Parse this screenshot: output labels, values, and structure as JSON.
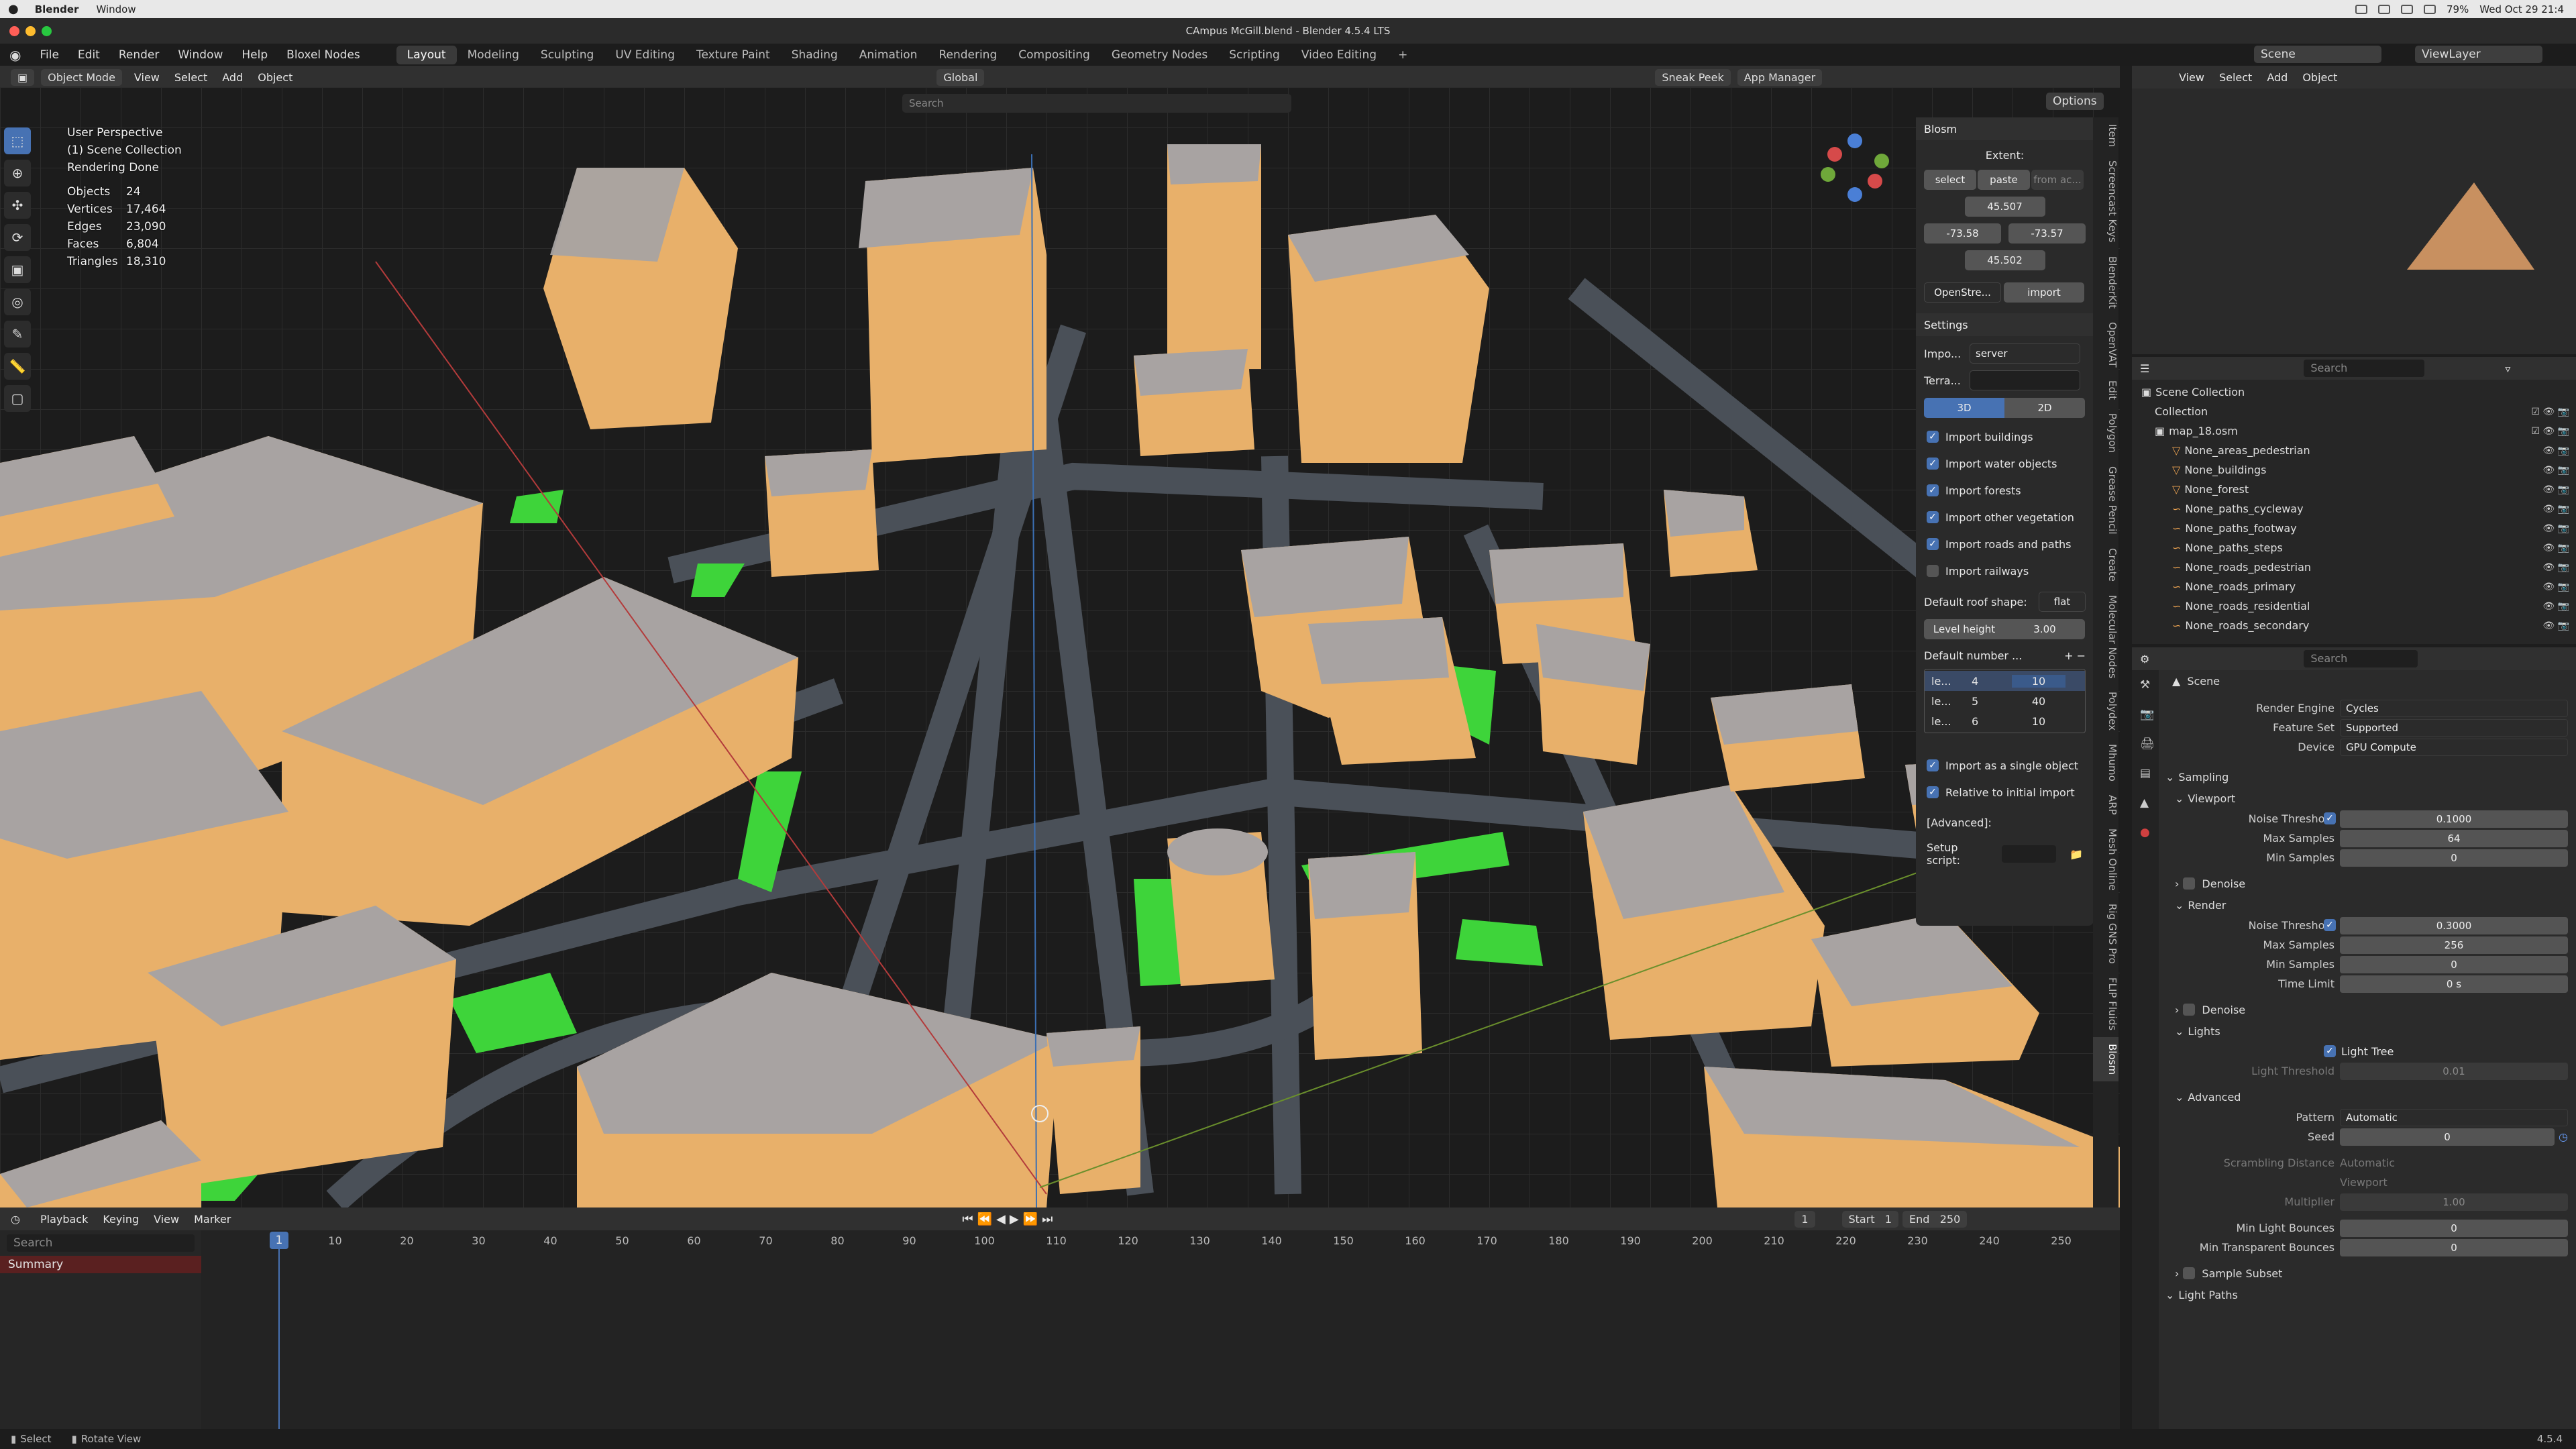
{
  "mac": {
    "app": "Blender",
    "window": "Window",
    "clock": "Wed Oct 29 21:4",
    "battery": "79%"
  },
  "window_title": "CAmpus McGill.blend - Blender 4.5.4 LTS",
  "menu": [
    "File",
    "Edit",
    "Render",
    "Window",
    "Help",
    "Bloxel Nodes"
  ],
  "workspaces": [
    "Layout",
    "Modeling",
    "Sculpting",
    "UV Editing",
    "Texture Paint",
    "Shading",
    "Animation",
    "Rendering",
    "Compositing",
    "Geometry Nodes",
    "Scripting",
    "Video Editing"
  ],
  "scene_name": "Scene",
  "view_layer": "ViewLayer",
  "viewport_header": {
    "mode": "Object Mode",
    "items": [
      "View",
      "Select",
      "Add",
      "Object"
    ],
    "orientation": "Global",
    "sneak_peek": "Sneak Peek",
    "app_manager": "App Manager",
    "options": "Options",
    "search_placeholder": "Search"
  },
  "overlay": {
    "perspective": "User Perspective",
    "collection": "(1) Scene Collection",
    "status": "Rendering Done",
    "stats": [
      [
        "Objects",
        "24"
      ],
      [
        "Vertices",
        "17,464"
      ],
      [
        "Edges",
        "23,090"
      ],
      [
        "Faces",
        "6,804"
      ],
      [
        "Triangles",
        "18,310"
      ]
    ]
  },
  "blosm": {
    "title": "Blosm",
    "extent_label": "Extent:",
    "select": "select",
    "paste": "paste",
    "from": "from ac...",
    "top": "45.507",
    "left": "-73.58",
    "right": "-73.57",
    "bottom": "45.502",
    "source": "OpenStre...",
    "import": "import"
  },
  "settings": {
    "title": "Settings",
    "import_label": "Impo...",
    "import_value": "server",
    "terrain_label": "Terra...",
    "mode_3d": "3D",
    "mode_2d": "2D",
    "checks": [
      {
        "label": "Import buildings",
        "on": true
      },
      {
        "label": "Import water objects",
        "on": true
      },
      {
        "label": "Import forests",
        "on": true
      },
      {
        "label": "Import other vegetation",
        "on": true
      },
      {
        "label": "Import roads and paths",
        "on": true
      },
      {
        "label": "Import railways",
        "on": false
      }
    ],
    "roof_label": "Default roof shape:",
    "roof_value": "flat",
    "level_height_label": "Level height",
    "level_height_value": "3.00",
    "default_number": "Default number ...",
    "levels": [
      [
        "le...",
        "4",
        "10"
      ],
      [
        "le...",
        "5",
        "40"
      ],
      [
        "le...",
        "6",
        "10"
      ]
    ],
    "single_object": "Import as a single object",
    "relative": "Relative to initial import",
    "advanced": "[Advanced]:",
    "setup_script": "Setup script:"
  },
  "vtabs": [
    "Blosm",
    "FLIP Fluids",
    "Rig GNS Pro",
    "Mesh Online",
    "ARP",
    "Mhumo",
    "Polydex",
    "Molecular Nodes",
    "Create",
    "Grease Pencil",
    "Polygon",
    "Edit",
    "OpenVAT",
    "BlenderKit",
    "Screencast Keys",
    "Item"
  ],
  "outliner": {
    "search": "Search",
    "rows": [
      {
        "label": "Scene Collection",
        "indent": 0
      },
      {
        "label": "Collection",
        "indent": 1
      },
      {
        "label": "map_18.osm",
        "indent": 1
      },
      {
        "label": "None_areas_pedestrian",
        "indent": 2
      },
      {
        "label": "None_buildings",
        "indent": 2
      },
      {
        "label": "None_forest",
        "indent": 2
      },
      {
        "label": "None_paths_cycleway",
        "indent": 2
      },
      {
        "label": "None_paths_footway",
        "indent": 2
      },
      {
        "label": "None_paths_steps",
        "indent": 2
      },
      {
        "label": "None_roads_pedestrian",
        "indent": 2
      },
      {
        "label": "None_roads_primary",
        "indent": 2
      },
      {
        "label": "None_roads_residential",
        "indent": 2
      },
      {
        "label": "None_roads_secondary",
        "indent": 2
      }
    ]
  },
  "properties": {
    "search": "Search",
    "scene": "Scene",
    "render_engine": [
      "Render Engine",
      "Cycles"
    ],
    "feature_set": [
      "Feature Set",
      "Supported"
    ],
    "device": [
      "Device",
      "GPU Compute"
    ],
    "sampling": "Sampling",
    "viewport": "Viewport",
    "noise_threshold": "Noise Threshold",
    "vp_noise": "0.1000",
    "max_samples": "Max Samples",
    "vp_max": "64",
    "min_samples": "Min Samples",
    "vp_min": "0",
    "denoise": "Denoise",
    "render": "Render",
    "r_noise": "0.3000",
    "r_max": "256",
    "r_min": "0",
    "time_limit": "Time Limit",
    "r_time": "0 s",
    "lights": "Lights",
    "light_tree": "Light Tree",
    "light_threshold": "Light Threshold",
    "lt_value": "0.01",
    "advanced": "Advanced",
    "pattern": "Pattern",
    "pattern_value": "Automatic",
    "seed": "Seed",
    "seed_value": "0",
    "scrambling": "Scrambling Distance",
    "scr_auto": "Automatic",
    "scr_viewport": "Viewport",
    "multiplier": "Multiplier",
    "mult_value": "1.00",
    "min_light_bounces": "Min Light Bounces",
    "mlb": "0",
    "min_transparent_bounces": "Min Transparent Bounces",
    "mtb": "0",
    "sample_subset": "Sample Subset",
    "light_paths": "Light Paths"
  },
  "timeline": {
    "menu": [
      "Playback",
      "Keying",
      "View",
      "Marker"
    ],
    "current": "1",
    "start_label": "Start",
    "start": "1",
    "end_label": "End",
    "end": "250",
    "summary": "Summary",
    "ticks": [
      "1",
      "10",
      "20",
      "30",
      "40",
      "50",
      "60",
      "70",
      "80",
      "90",
      "100",
      "110",
      "120",
      "130",
      "140",
      "150",
      "160",
      "170",
      "180",
      "190",
      "200",
      "210",
      "220",
      "230",
      "240",
      "250"
    ]
  },
  "status": {
    "select": "Select",
    "rotate": "Rotate View",
    "version": "4.5.4"
  },
  "colors": {
    "building_wall": "#e8b06a",
    "building_roof": "#a8a3a2",
    "green": "#3ed43a",
    "road": "#4a5058",
    "ground": "#1c1c1c",
    "accent": "#4772b3"
  }
}
